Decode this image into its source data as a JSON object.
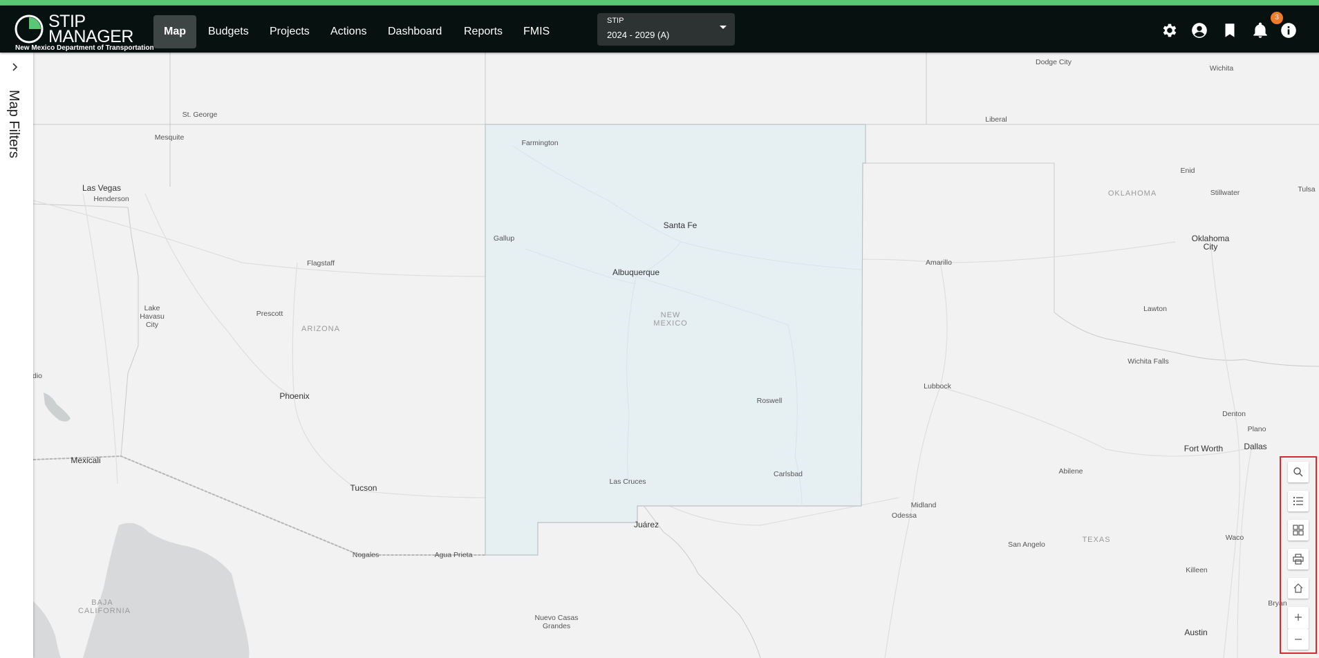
{
  "header": {
    "logo_line1": "STIP",
    "logo_line2": "MANAGER",
    "logo_subtitle": "New Mexico Department of Transportation",
    "nav": [
      {
        "label": "Map",
        "active": true
      },
      {
        "label": "Budgets"
      },
      {
        "label": "Projects"
      },
      {
        "label": "Actions"
      },
      {
        "label": "Dashboard"
      },
      {
        "label": "Reports"
      },
      {
        "label": "FMIS"
      }
    ],
    "stip_select": {
      "label": "STIP",
      "value": "2024 - 2029 (A)"
    },
    "icons": [
      "gear-icon",
      "account-icon",
      "bookmark-icon",
      "bell-icon",
      "info-icon"
    ],
    "notification_count": "3"
  },
  "sidebar": {
    "title": "Map Filters",
    "toggle_icon": "chevron-right-icon"
  },
  "map": {
    "labels": {
      "dodge_city": "Dodge City",
      "wichita": "Wichita",
      "st_george": "St. George",
      "liberal": "Liberal",
      "mesquite": "Mesquite",
      "farmington": "Farmington",
      "enid": "Enid",
      "las_vegas": "Las Vegas",
      "henderson": "Henderson",
      "oklahoma": "OKLAHOMA",
      "stillwater": "Stillwater",
      "tulsa": "Tulsa",
      "santa_fe": "Santa Fe",
      "gallup": "Gallup",
      "oklahoma_city": "Oklahoma City",
      "flagstaff": "Flagstaff",
      "amarillo": "Amarillo",
      "albuquerque": "Albuquerque",
      "lake_havasu": "Lake Havasu City",
      "prescott": "Prescott",
      "lawton": "Lawton",
      "new_mexico": "NEW MEXICO",
      "arizona": "ARIZONA",
      "wichita_falls": "Wichita Falls",
      "dio": "dio",
      "lubbock": "Lubbock",
      "phoenix": "Phoenix",
      "roswell": "Roswell",
      "denton": "Denton",
      "plano": "Plano",
      "fort_worth": "Fort Worth",
      "dallas": "Dallas",
      "mexicali": "Mexicali",
      "abilene": "Abilene",
      "carlsbad": "Carlsbad",
      "las_cruces": "Las Cruces",
      "tucson": "Tucson",
      "midland": "Midland",
      "odessa": "Odessa",
      "juarez": "Juárez",
      "waco": "Waco",
      "texas": "TEXAS",
      "san_angelo": "San Angelo",
      "nogales": "Nogales",
      "agua_prieta": "Agua Prieta",
      "killeen": "Killeen",
      "bryan": "Bryan",
      "baja_california": "BAJA CALIFORNIA",
      "nuevo_casas_grandes": "Nuevo Casas Grandes",
      "austin": "Austin"
    },
    "tools": [
      "search-icon",
      "legend-list-icon",
      "basemap-grid-icon",
      "print-icon",
      "home-icon",
      "zoom-in-icon",
      "zoom-out-icon"
    ],
    "colors": {
      "highlight_fill": "#e6f0f3",
      "accent": "#5ac775",
      "tools_border": "#d9292d"
    }
  }
}
